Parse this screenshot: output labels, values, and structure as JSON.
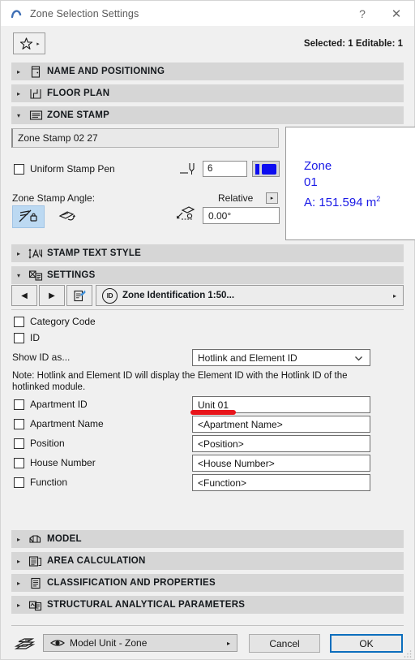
{
  "window": {
    "title": "Zone Selection Settings",
    "icon": "archicad-logo-icon",
    "help_label": "?",
    "close_label": "✕"
  },
  "toolbar": {
    "favorites_icon": "star-icon",
    "favorites_caret": "▸",
    "selection_info": "Selected: 1 Editable: 1"
  },
  "sections": [
    {
      "label": "NAME AND POSITIONING",
      "expanded": false,
      "triangle": "▸",
      "icon": "name-positioning-icon"
    },
    {
      "label": "FLOOR PLAN",
      "expanded": false,
      "triangle": "▸",
      "icon": "floor-plan-icon"
    },
    {
      "label": "ZONE STAMP",
      "expanded": true,
      "triangle": "▾",
      "icon": "zone-stamp-icon"
    },
    {
      "label": "STAMP TEXT STYLE",
      "expanded": false,
      "triangle": "▸",
      "icon": "text-style-icon"
    },
    {
      "label": "SETTINGS",
      "expanded": true,
      "triangle": "▾",
      "icon": "settings-icon"
    },
    {
      "label": "MODEL",
      "expanded": false,
      "triangle": "▸",
      "icon": "model-icon"
    },
    {
      "label": "AREA CALCULATION",
      "expanded": false,
      "triangle": "▸",
      "icon": "area-calculation-icon"
    },
    {
      "label": "CLASSIFICATION AND PROPERTIES",
      "expanded": false,
      "triangle": "▸",
      "icon": "classification-icon"
    },
    {
      "label": "STRUCTURAL ANALYTICAL PARAMETERS",
      "expanded": false,
      "triangle": "▸",
      "icon": "structural-icon"
    }
  ],
  "zone_stamp": {
    "stamp_name": "Zone Stamp 02 27",
    "preview": {
      "line1": "Zone",
      "line2": "01",
      "line3_prefix": "A: 151.594 m",
      "line3_sup": "2",
      "color": "#1a1ae6"
    },
    "uniform_stamp_pen": {
      "label": "Uniform Stamp Pen",
      "checked": false
    },
    "pen_icon": "pen-icon",
    "pen_number": "6",
    "pen_color": "#0d0df0",
    "angle_label": "Zone Stamp Angle:",
    "angle_mode": "Relative",
    "angle_mode_caret": "▸",
    "angle_value": "0.00°",
    "angle_icon": "rotate-angle-icon",
    "toggle_fixed": {
      "icon": "stamp-fixed-angle-icon",
      "selected": true
    },
    "toggle_rotate": {
      "icon": "stamp-rotate-icon",
      "selected": false
    }
  },
  "settings": {
    "nav": {
      "prev_label": "◀",
      "next_label": "▶",
      "edit_icon": "edit-settings-icon",
      "scheme_icon": "id-icon",
      "scheme_icon_text": "ID",
      "scheme_name": "Zone Identification 1:50...",
      "caret": "▸"
    },
    "checks": [
      {
        "label": "Category Code",
        "checked": false
      },
      {
        "label": "ID",
        "checked": false
      }
    ],
    "show_id_label": "Show ID as...",
    "show_id_value": "Hotlink and Element ID",
    "note": "Note: Hotlink and Element ID will display the Element ID with the Hotlink ID of the hotlinked module.",
    "fields": [
      {
        "label": "Apartment ID",
        "checked": false,
        "value": "Unit 01",
        "annotated": true
      },
      {
        "label": "Apartment Name",
        "checked": false,
        "value": "<Apartment Name>",
        "annotated": false
      },
      {
        "label": "Position",
        "checked": false,
        "value": "<Position>",
        "annotated": false
      },
      {
        "label": "House Number",
        "checked": false,
        "value": "<House Number>",
        "annotated": false
      },
      {
        "label": "Function",
        "checked": false,
        "value": "<Function>",
        "annotated": false
      }
    ],
    "annotation_color": "#e8151b"
  },
  "footer": {
    "layer_icon": "layers-icon",
    "eye_icon": "eye-icon",
    "unit_value": "Model Unit - Zone",
    "unit_caret": "▸",
    "cancel_label": "Cancel",
    "ok_label": "OK",
    "ok_border_color": "#0c6ebd"
  }
}
